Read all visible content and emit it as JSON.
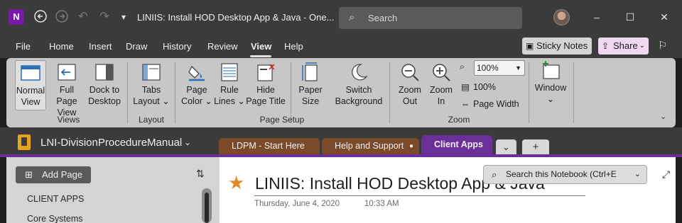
{
  "titlebar": {
    "app_icon": "N",
    "document_title": "LINIIS: Install HOD Desktop App & Java  -  One...",
    "search_placeholder": "Search",
    "minimize": "–",
    "maximize": "☐",
    "close": "✕"
  },
  "menu": {
    "tabs": [
      "File",
      "Home",
      "Insert",
      "Draw",
      "History",
      "Review",
      "View",
      "Help"
    ],
    "active_tab": "View",
    "sticky_notes": "Sticky Notes",
    "share": "Share"
  },
  "ribbon": {
    "views": {
      "normal_view": [
        "Normal",
        "View"
      ],
      "full_page_view": [
        "Full Page",
        "View"
      ],
      "dock_to_desktop": [
        "Dock to",
        "Desktop"
      ],
      "label": "Views"
    },
    "layout": {
      "tabs_layout": [
        "Tabs",
        "Layout ⌄"
      ],
      "label": "Layout"
    },
    "page_setup": {
      "page_color": [
        "Page",
        "Color ⌄"
      ],
      "rule_lines": [
        "Rule",
        "Lines ⌄"
      ],
      "hide_page_title": [
        "Hide",
        "Page Title"
      ],
      "paper_size": [
        "Paper",
        "Size"
      ],
      "switch_background": [
        "Switch",
        "Background"
      ],
      "label": "Page Setup"
    },
    "zoom": {
      "zoom_out": [
        "Zoom",
        "Out"
      ],
      "zoom_in": [
        "Zoom",
        "In"
      ],
      "zoom_value": "100%",
      "hundred_percent": "100%",
      "page_width": "Page Width",
      "label": "Zoom"
    },
    "window": {
      "label": "Window",
      "chevron": "⌄"
    }
  },
  "notebook": {
    "name": "LNI-DivisionProcedureManual",
    "sections": [
      "LDPM - Start Here",
      "Help and Support",
      "Client Apps"
    ],
    "active_section": "Client Apps",
    "add_section": "+",
    "more_sections": "⌄"
  },
  "pages_pane": {
    "add_page": "Add Page",
    "items": [
      "CLIENT APPS",
      "Core Systems"
    ]
  },
  "page": {
    "title": "LINIIS: Install HOD Desktop App & Java",
    "date": "Thursday, June 4, 2020",
    "time": "10:33 AM",
    "search_notebook": "Search this Notebook (Ctrl+E"
  },
  "colors": {
    "accent_purple": "#6b2f9a",
    "section_brown": "#7b4a2a",
    "ribbon_bg": "#c7c7c7",
    "star_orange": "#e08a2e",
    "share_pink": "#f0d8f3"
  }
}
